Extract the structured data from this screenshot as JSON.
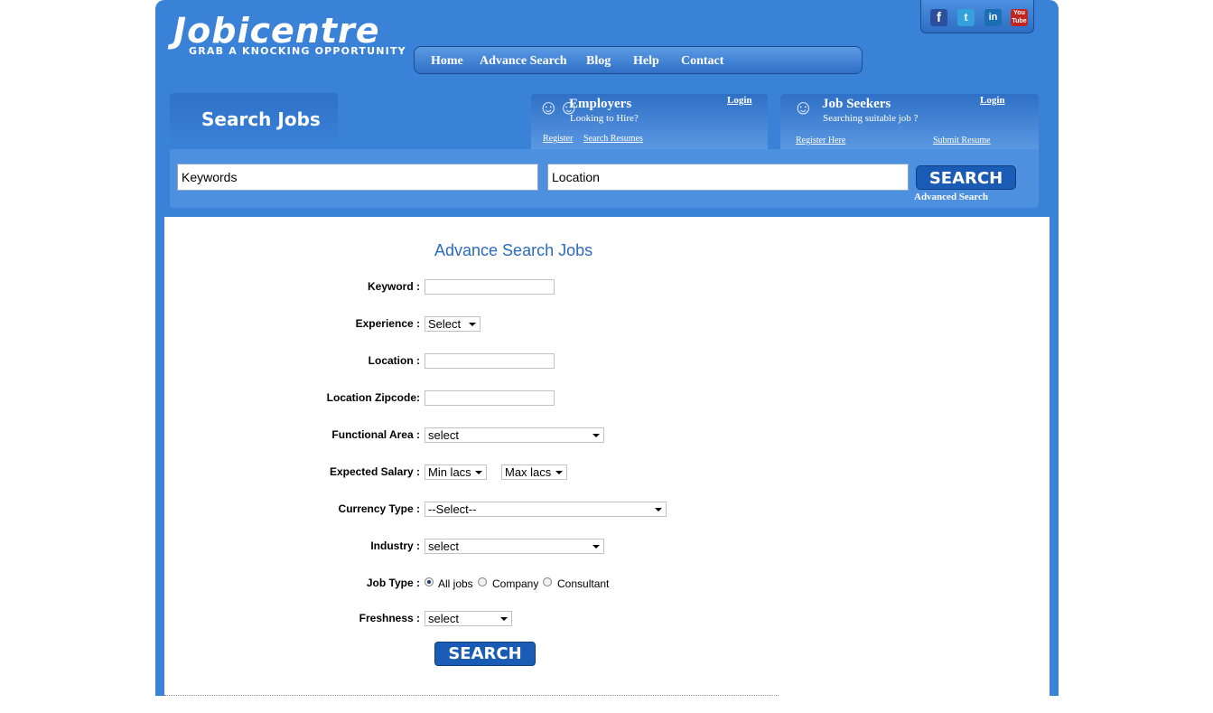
{
  "brand": {
    "title": "Jobicentre",
    "tagline": "GRAB A KNOCKING OPPORTUNITY"
  },
  "nav": [
    "Home",
    "Advance Search",
    "Blog",
    "Help",
    "Contact"
  ],
  "social": {
    "facebook": "f",
    "twitter": "t",
    "linkedin": "in",
    "youtube": "You Tube"
  },
  "search_tab": "Search Jobs",
  "employers": {
    "title": "Employers",
    "subtitle": "Looking to Hire?",
    "login": "Login",
    "register": "Register",
    "search_resumes": "Search Resumes"
  },
  "job_seekers": {
    "title": "Job Seekers",
    "subtitle": "Searching suitable job ?",
    "login": "Login",
    "register": "Register Here",
    "submit_resume": "Submit Resume"
  },
  "searchbar": {
    "keywords_placeholder": "Keywords",
    "location_placeholder": "Location",
    "button": "SEARCH",
    "advanced": "Advanced Search"
  },
  "form": {
    "title": "Advance Search Jobs",
    "labels": {
      "keyword": "Keyword :",
      "experience": "Experience :",
      "location": "Location :",
      "zipcode": "Location Zipcode:",
      "functional_area": "Functional Area :",
      "salary": "Expected Salary :",
      "currency": "Currency Type :",
      "industry": "Industry :",
      "job_type": "Job Type :",
      "freshness": "Freshness :"
    },
    "experience_value": "Select",
    "functional_area_value": "select",
    "min_salary": "Min lacs",
    "max_salary": "Max lacs",
    "currency_value": "--Select--",
    "industry_value": "select",
    "freshness_value": "select",
    "job_types": [
      "All jobs",
      "Company",
      "Consultant"
    ],
    "job_type_selected": "All jobs",
    "button": "SEARCH"
  },
  "colors": {
    "primary": "#3a82d8",
    "button": "#1a5cb5",
    "title": "#2a6ac0"
  }
}
